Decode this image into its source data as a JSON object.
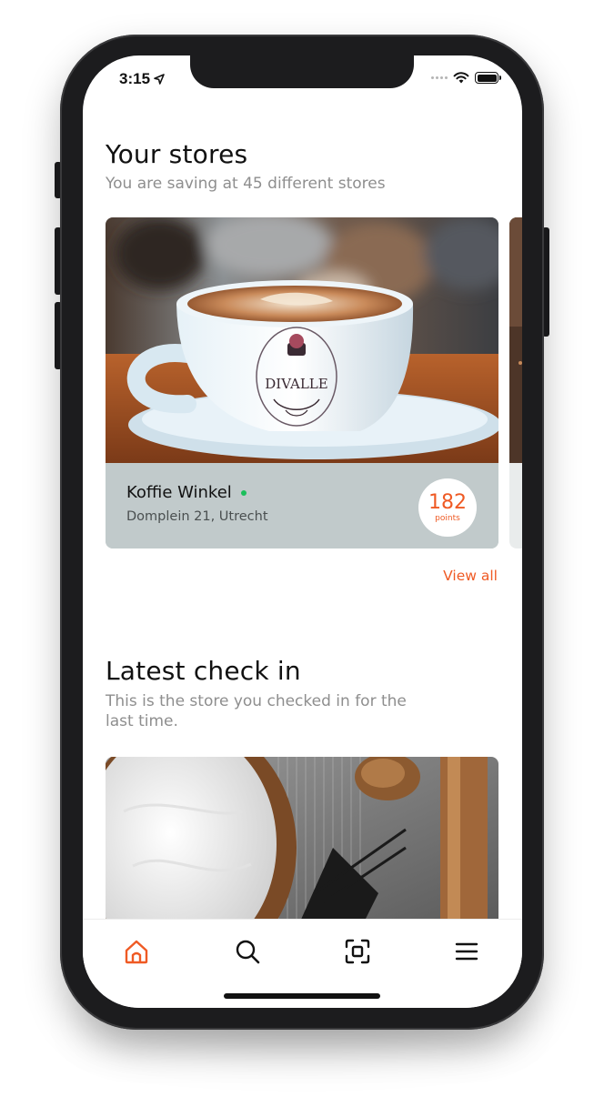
{
  "status_bar": {
    "time": "3:15"
  },
  "stores_section": {
    "title": "Your stores",
    "subtitle": "You are saving at 45 different stores",
    "view_all_label": "View all",
    "featured_store": {
      "name": "Koffie Winkel",
      "address": "Domplein 21, Utrecht",
      "points_value": "182",
      "points_label": "points",
      "cup_brand": "DIVALLE"
    }
  },
  "checkin_section": {
    "title": "Latest check in",
    "subtitle_line1": "This is the store you checked in for the",
    "subtitle_line2": "last time."
  },
  "tab_bar": {
    "items": [
      {
        "icon": "home-icon",
        "active": true
      },
      {
        "icon": "search-icon",
        "active": false
      },
      {
        "icon": "scan-icon",
        "active": false
      },
      {
        "icon": "menu-icon",
        "active": false
      }
    ]
  },
  "colors": {
    "accent": "#ef5a24",
    "online": "#1bbf5b",
    "card_info_bg": "#c1cacb",
    "text_primary": "#111111",
    "text_secondary": "#8e8e8e"
  }
}
